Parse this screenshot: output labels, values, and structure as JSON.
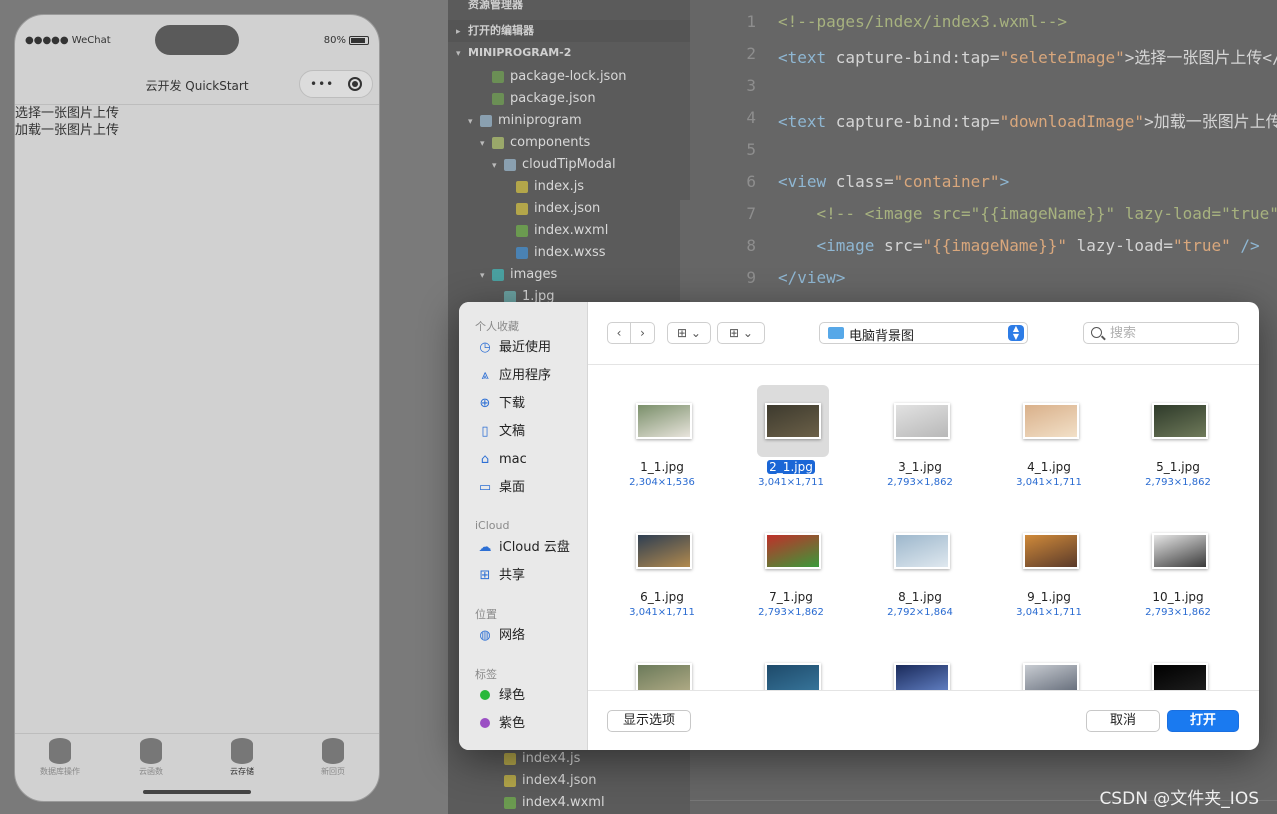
{
  "phone": {
    "carrier": "●●●●● WeChat",
    "battery": "80%",
    "nav_title": "云开发 QuickStart",
    "capsule_dots": "•••",
    "content_lines": [
      "选择一张图片上传",
      "加载一张图片上传"
    ],
    "tabs": [
      {
        "label": "数据库操作"
      },
      {
        "label": "云函数"
      },
      {
        "label": "云存储"
      },
      {
        "label": "新回页"
      }
    ]
  },
  "explorer": {
    "top_header": "资源管理器",
    "open_editors": "打开的编辑器",
    "project": "MINIPROGRAM-2",
    "items": [
      {
        "label": "package-lock.json",
        "indent": 2,
        "icon_color": "#6b8f55",
        "arrow": ""
      },
      {
        "label": "package.json",
        "indent": 2,
        "icon_color": "#6b8f55",
        "arrow": ""
      },
      {
        "label": "miniprogram",
        "indent": 1,
        "icon_color": "#8aa0b0",
        "arrow": "▾"
      },
      {
        "label": "components",
        "indent": 2,
        "icon_color": "#9aa86a",
        "arrow": "▾"
      },
      {
        "label": "cloudTipModal",
        "indent": 3,
        "icon_color": "#8aa0b0",
        "arrow": "▾"
      },
      {
        "label": "index.js",
        "indent": 4,
        "icon_color": "#b3a64a",
        "arrow": ""
      },
      {
        "label": "index.json",
        "indent": 4,
        "icon_color": "#b3a64a",
        "arrow": ""
      },
      {
        "label": "index.wxml",
        "indent": 4,
        "icon_color": "#6b9a50",
        "arrow": ""
      },
      {
        "label": "index.wxss",
        "indent": 4,
        "icon_color": "#4a82b3",
        "arrow": ""
      },
      {
        "label": "images",
        "indent": 2,
        "icon_color": "#4aa0a0",
        "arrow": "▾"
      },
      {
        "label": "1.jpg",
        "indent": 3,
        "icon_color": "#6aa0a0",
        "arrow": ""
      }
    ],
    "bottom_items": [
      {
        "label": "index4.js",
        "icon_color": "#b3a64a"
      },
      {
        "label": "index4.json",
        "icon_color": "#b3a64a"
      },
      {
        "label": "index4.wxml",
        "icon_color": "#6b9a50"
      }
    ]
  },
  "editor": {
    "line_numbers": [
      "1",
      "2",
      "3",
      "4",
      "5",
      "6",
      "7",
      "8",
      "9"
    ],
    "lines": [
      [
        {
          "t": "<!--pages/index/index3.wxml-->",
          "c": "c-com"
        }
      ],
      [
        {
          "t": "<text ",
          "c": "c-tag"
        },
        {
          "t": "capture-bind:tap=",
          "c": "c-att"
        },
        {
          "t": "\"seleteImage\"",
          "c": "c-str"
        },
        {
          "t": ">选择一张图片上传</",
          "c": "c-att"
        }
      ],
      [],
      [
        {
          "t": "<text ",
          "c": "c-tag"
        },
        {
          "t": "capture-bind:tap=",
          "c": "c-att"
        },
        {
          "t": "\"downloadImage\"",
          "c": "c-str"
        },
        {
          "t": ">加载一张图片上传",
          "c": "c-att"
        }
      ],
      [],
      [
        {
          "t": "<view ",
          "c": "c-tag"
        },
        {
          "t": "class=",
          "c": "c-att"
        },
        {
          "t": "\"container\"",
          "c": "c-str"
        },
        {
          "t": ">",
          "c": "c-tag"
        }
      ],
      [
        {
          "t": "    <!-- <image src=\"{{imageName}}\" lazy-load=\"true\"",
          "c": "c-com"
        }
      ],
      [
        {
          "t": "    <image ",
          "c": "c-tag"
        },
        {
          "t": "src=",
          "c": "c-att"
        },
        {
          "t": "\"{{imageName}}\"",
          "c": "c-str"
        },
        {
          "t": " lazy-load=",
          "c": "c-att"
        },
        {
          "t": "\"true\"",
          "c": "c-str"
        },
        {
          "t": " />",
          "c": "c-tag"
        }
      ],
      [
        {
          "t": "</view>",
          "c": "c-tag"
        }
      ]
    ]
  },
  "watermark": "CSDN @文件夹_IOS",
  "dialog": {
    "sidebar": {
      "favorites_title": "个人收藏",
      "favorites": [
        {
          "label": "最近使用",
          "icon": "clock-icon",
          "glyph": "◷"
        },
        {
          "label": "应用程序",
          "icon": "applications-icon",
          "glyph": "⩓"
        },
        {
          "label": "下载",
          "icon": "download-icon",
          "glyph": "⊕"
        },
        {
          "label": "文稿",
          "icon": "document-icon",
          "glyph": "▯"
        },
        {
          "label": "mac",
          "icon": "home-icon",
          "glyph": "⌂"
        },
        {
          "label": "桌面",
          "icon": "desktop-icon",
          "glyph": "▭"
        }
      ],
      "icloud_title": "iCloud",
      "icloud": [
        {
          "label": "iCloud 云盘",
          "icon": "cloud-icon",
          "glyph": "☁"
        },
        {
          "label": "共享",
          "icon": "shared-folder-icon",
          "glyph": "⊞"
        }
      ],
      "locations_title": "位置",
      "locations": [
        {
          "label": "网络",
          "icon": "network-icon",
          "glyph": "◍"
        }
      ],
      "tags_title": "标签",
      "tags": [
        {
          "label": "绿色",
          "color": "#28b83a"
        },
        {
          "label": "紫色",
          "color": "#9b4fc4"
        }
      ]
    },
    "toolbar": {
      "back": "‹",
      "forward": "›",
      "view_icon": "⊞ ⌄",
      "group_icon": "⊞ ⌄",
      "location": "电脑背景图",
      "search_placeholder": "搜索"
    },
    "files": [
      {
        "name": "1_1.jpg",
        "dims": "2,304×1,536",
        "selected": false,
        "c1": "#7a8f6a",
        "c2": "#e8e4dc"
      },
      {
        "name": "2_1.jpg",
        "dims": "3,041×1,711",
        "selected": true,
        "c1": "#3d3a2e",
        "c2": "#6b6048"
      },
      {
        "name": "3_1.jpg",
        "dims": "2,793×1,862",
        "selected": false,
        "c1": "#e2e2e2",
        "c2": "#b8b8b8"
      },
      {
        "name": "4_1.jpg",
        "dims": "3,041×1,711",
        "selected": false,
        "c1": "#d9b08a",
        "c2": "#f2e0c8"
      },
      {
        "name": "5_1.jpg",
        "dims": "2,793×1,862",
        "selected": false,
        "c1": "#2e3a2a",
        "c2": "#6f7a5a"
      },
      {
        "name": "6_1.jpg",
        "dims": "3,041×1,711",
        "selected": false,
        "c1": "#2e3e52",
        "c2": "#b28a4e"
      },
      {
        "name": "7_1.jpg",
        "dims": "2,793×1,862",
        "selected": false,
        "c1": "#c0302a",
        "c2": "#3a9a3a"
      },
      {
        "name": "8_1.jpg",
        "dims": "2,792×1,864",
        "selected": false,
        "c1": "#9db7cc",
        "c2": "#dfe8ef"
      },
      {
        "name": "9_1.jpg",
        "dims": "3,041×1,711",
        "selected": false,
        "c1": "#d08a3a",
        "c2": "#5a3a2a"
      },
      {
        "name": "10_1.jpg",
        "dims": "2,793×1,862",
        "selected": false,
        "c1": "#e6e6e6",
        "c2": "#3a3a3a"
      },
      {
        "name": "",
        "dims": "",
        "selected": false,
        "c1": "#6b7a5a",
        "c2": "#b8b08a"
      },
      {
        "name": "",
        "dims": "",
        "selected": false,
        "c1": "#1e4a6a",
        "c2": "#3a7aa0"
      },
      {
        "name": "",
        "dims": "",
        "selected": false,
        "c1": "#1a2a5a",
        "c2": "#6a8ad0"
      },
      {
        "name": "",
        "dims": "",
        "selected": false,
        "c1": "#c8ccd2",
        "c2": "#5a6270"
      },
      {
        "name": "",
        "dims": "",
        "selected": false,
        "c1": "#000000",
        "c2": "#222222"
      }
    ],
    "footer": {
      "options": "显示选项",
      "cancel": "取消",
      "open": "打开"
    },
    "colors": {
      "accent": "#1a7af0",
      "selection": "#1a66d6",
      "dims_text": "#2a6bd1"
    }
  }
}
